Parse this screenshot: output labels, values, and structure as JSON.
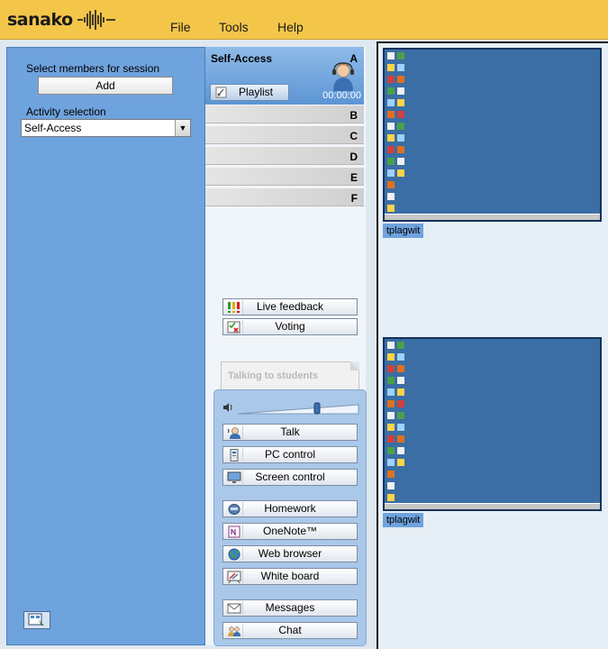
{
  "app": {
    "logo": "sanako",
    "menu": [
      "File",
      "Tools",
      "Help"
    ]
  },
  "left_panel": {
    "select_members_label": "Select members for session",
    "add_label": "Add",
    "activity_label": "Activity selection",
    "activity_value": "Self-Access"
  },
  "groups": {
    "a_title": "Self-Access",
    "a_letter": "A",
    "playlist_label": "Playlist",
    "timer": "00:00:00",
    "rows": [
      "B",
      "C",
      "D",
      "E",
      "F"
    ]
  },
  "tools": {
    "live_feedback": "Live feedback",
    "voting": "Voting",
    "talking_to_students": "Talking to students",
    "talk": "Talk",
    "pc_control": "PC control",
    "screen_control": "Screen control",
    "homework": "Homework",
    "onenote": "OneNote™",
    "web_browser": "Web browser",
    "white_board": "White board",
    "messages": "Messages",
    "chat": "Chat"
  },
  "screens": [
    {
      "label": "tplagwit"
    },
    {
      "label": "tplagwit"
    }
  ],
  "colors": {
    "topbar": "#f3c64a",
    "left_panel": "#6fa3dd",
    "desktop": "#3a6ea5"
  }
}
